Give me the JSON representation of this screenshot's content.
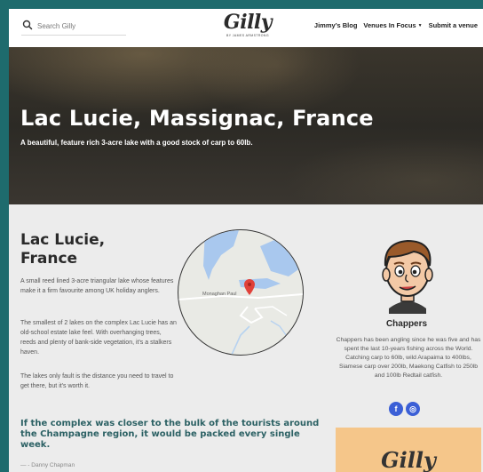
{
  "header": {
    "search_placeholder": "Search Gilly",
    "logo_text": "Gilly",
    "logo_subtext": "BY JAMES ARMSTRONG",
    "nav": [
      {
        "label": "Jimmy’s Blog"
      },
      {
        "label": "Venues In Focus",
        "has_dropdown": true
      },
      {
        "label": "Submit a venue"
      }
    ]
  },
  "hero": {
    "title": "Lac Lucie, Massignac, France",
    "subtitle": "A beautiful, feature rich 3-acre lake with a good stock of carp to 60lb."
  },
  "main": {
    "title": "Lac Lucie, France",
    "paragraphs": [
      "A small reed lined 3-acre triangular lake whose features make it a firm favourite among UK holiday anglers.",
      "The smallest of 2 lakes on the complex Lac Lucie has an old-school estate lake feel. With overhanging trees, reeds and plenty of bank-side vegetation, it's a stalkers haven.",
      "The lakes only fault is the distance you need to travel to get there, but it's worth it."
    ],
    "map_label": "Monaghan Paul",
    "quote": "If the complex was closer to the bulk of the tourists around the Champagne region, it would be packed every single week.",
    "quote_author": "— - Danny Chapman"
  },
  "sidebar": {
    "author_name": "Chappers",
    "author_bio": "Chappers has been angling since he was five and has spent the last 10-years fishing across the World. Catching carp to 60lb, wild Arapaima to 400lbs, Siamese carp over 200lb, Maekong Catfish to 250lb and 100lb Redtail catfish.",
    "socials": [
      {
        "icon": "facebook-icon",
        "glyph": "f"
      },
      {
        "icon": "instagram-icon",
        "glyph": "◎"
      }
    ],
    "promo_logo": "Gilly"
  },
  "colors": {
    "frame": "#1e6b6d",
    "quote": "#2c6164",
    "social": "#3b5fd6",
    "promo": "#f5c68a",
    "pin": "#e0413a"
  }
}
